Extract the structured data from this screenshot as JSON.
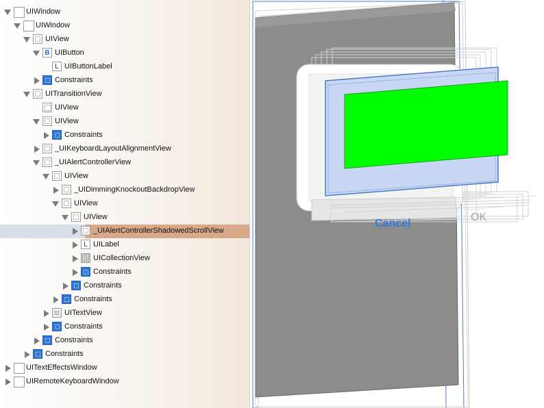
{
  "hierarchy": {
    "rows": [
      {
        "label": "UIWindow",
        "icon": "window-icon",
        "depth": 0,
        "disclosure": "open"
      },
      {
        "label": "UIWindow",
        "icon": "window-icon",
        "depth": 1,
        "disclosure": "open"
      },
      {
        "label": "UIView",
        "icon": "view-icon",
        "depth": 2,
        "disclosure": "open"
      },
      {
        "label": "UIButton",
        "icon": "button-icon",
        "depth": 3,
        "disclosure": "open"
      },
      {
        "label": "UIButtonLabel",
        "icon": "label-icon",
        "depth": 4,
        "disclosure": "none"
      },
      {
        "label": "Constraints",
        "icon": "constraints-icon",
        "depth": 3,
        "disclosure": "closed"
      },
      {
        "label": "UITransitionView",
        "icon": "view-icon",
        "depth": 2,
        "disclosure": "open"
      },
      {
        "label": "UIView",
        "icon": "plain-view-icon",
        "depth": 3,
        "disclosure": "none"
      },
      {
        "label": "UIView",
        "icon": "view-icon",
        "depth": 3,
        "disclosure": "open"
      },
      {
        "label": "Constraints",
        "icon": "constraints-icon",
        "depth": 4,
        "disclosure": "closed"
      },
      {
        "label": "_UIKeyboardLayoutAlignmentView",
        "icon": "view-icon",
        "depth": 3,
        "disclosure": "closed"
      },
      {
        "label": "_UIAlertControllerView",
        "icon": "view-icon",
        "depth": 3,
        "disclosure": "open"
      },
      {
        "label": "UIView",
        "icon": "view-icon",
        "depth": 4,
        "disclosure": "open"
      },
      {
        "label": "_UIDimmingKnockoutBackdropView",
        "icon": "view-icon",
        "depth": 5,
        "disclosure": "closed"
      },
      {
        "label": "UIView",
        "icon": "view-icon",
        "depth": 5,
        "disclosure": "open"
      },
      {
        "label": "UIView",
        "icon": "view-icon",
        "depth": 6,
        "disclosure": "open"
      },
      {
        "label": "_UIAlertControllerShadowedScrollView",
        "icon": "view-icon",
        "depth": 7,
        "disclosure": "closed",
        "selected": true
      },
      {
        "label": "UILabel",
        "icon": "label-icon",
        "depth": 7,
        "disclosure": "closed"
      },
      {
        "label": "UICollectionView",
        "icon": "collection-view-icon",
        "depth": 7,
        "disclosure": "closed"
      },
      {
        "label": "Constraints",
        "icon": "constraints-icon",
        "depth": 7,
        "disclosure": "closed"
      },
      {
        "label": "Constraints",
        "icon": "constraints-icon",
        "depth": 6,
        "disclosure": "closed"
      },
      {
        "label": "Constraints",
        "icon": "constraints-icon",
        "depth": 5,
        "disclosure": "closed"
      },
      {
        "label": "UITextView",
        "icon": "text-view-icon",
        "depth": 4,
        "disclosure": "closed"
      },
      {
        "label": "Constraints",
        "icon": "constraints-icon",
        "depth": 4,
        "disclosure": "closed"
      },
      {
        "label": "Constraints",
        "icon": "constraints-icon",
        "depth": 3,
        "disclosure": "closed"
      },
      {
        "label": "Constraints",
        "icon": "constraints-icon",
        "depth": 2,
        "disclosure": "closed"
      },
      {
        "label": "UITextEffectsWindow",
        "icon": "window-icon",
        "depth": 0,
        "disclosure": "closed"
      },
      {
        "label": "UIRemoteKeyboardWindow",
        "icon": "window-icon",
        "depth": 0,
        "disclosure": "closed"
      }
    ]
  },
  "canvas": {
    "cancel_label": "Cancel",
    "ok_label": "OK",
    "colors": {
      "highlight_green": "#00ff00",
      "selection_blue": "#c8d8f4",
      "accent_blue": "#2f7ae0",
      "backdrop_gray": "#8c8c8c"
    }
  }
}
